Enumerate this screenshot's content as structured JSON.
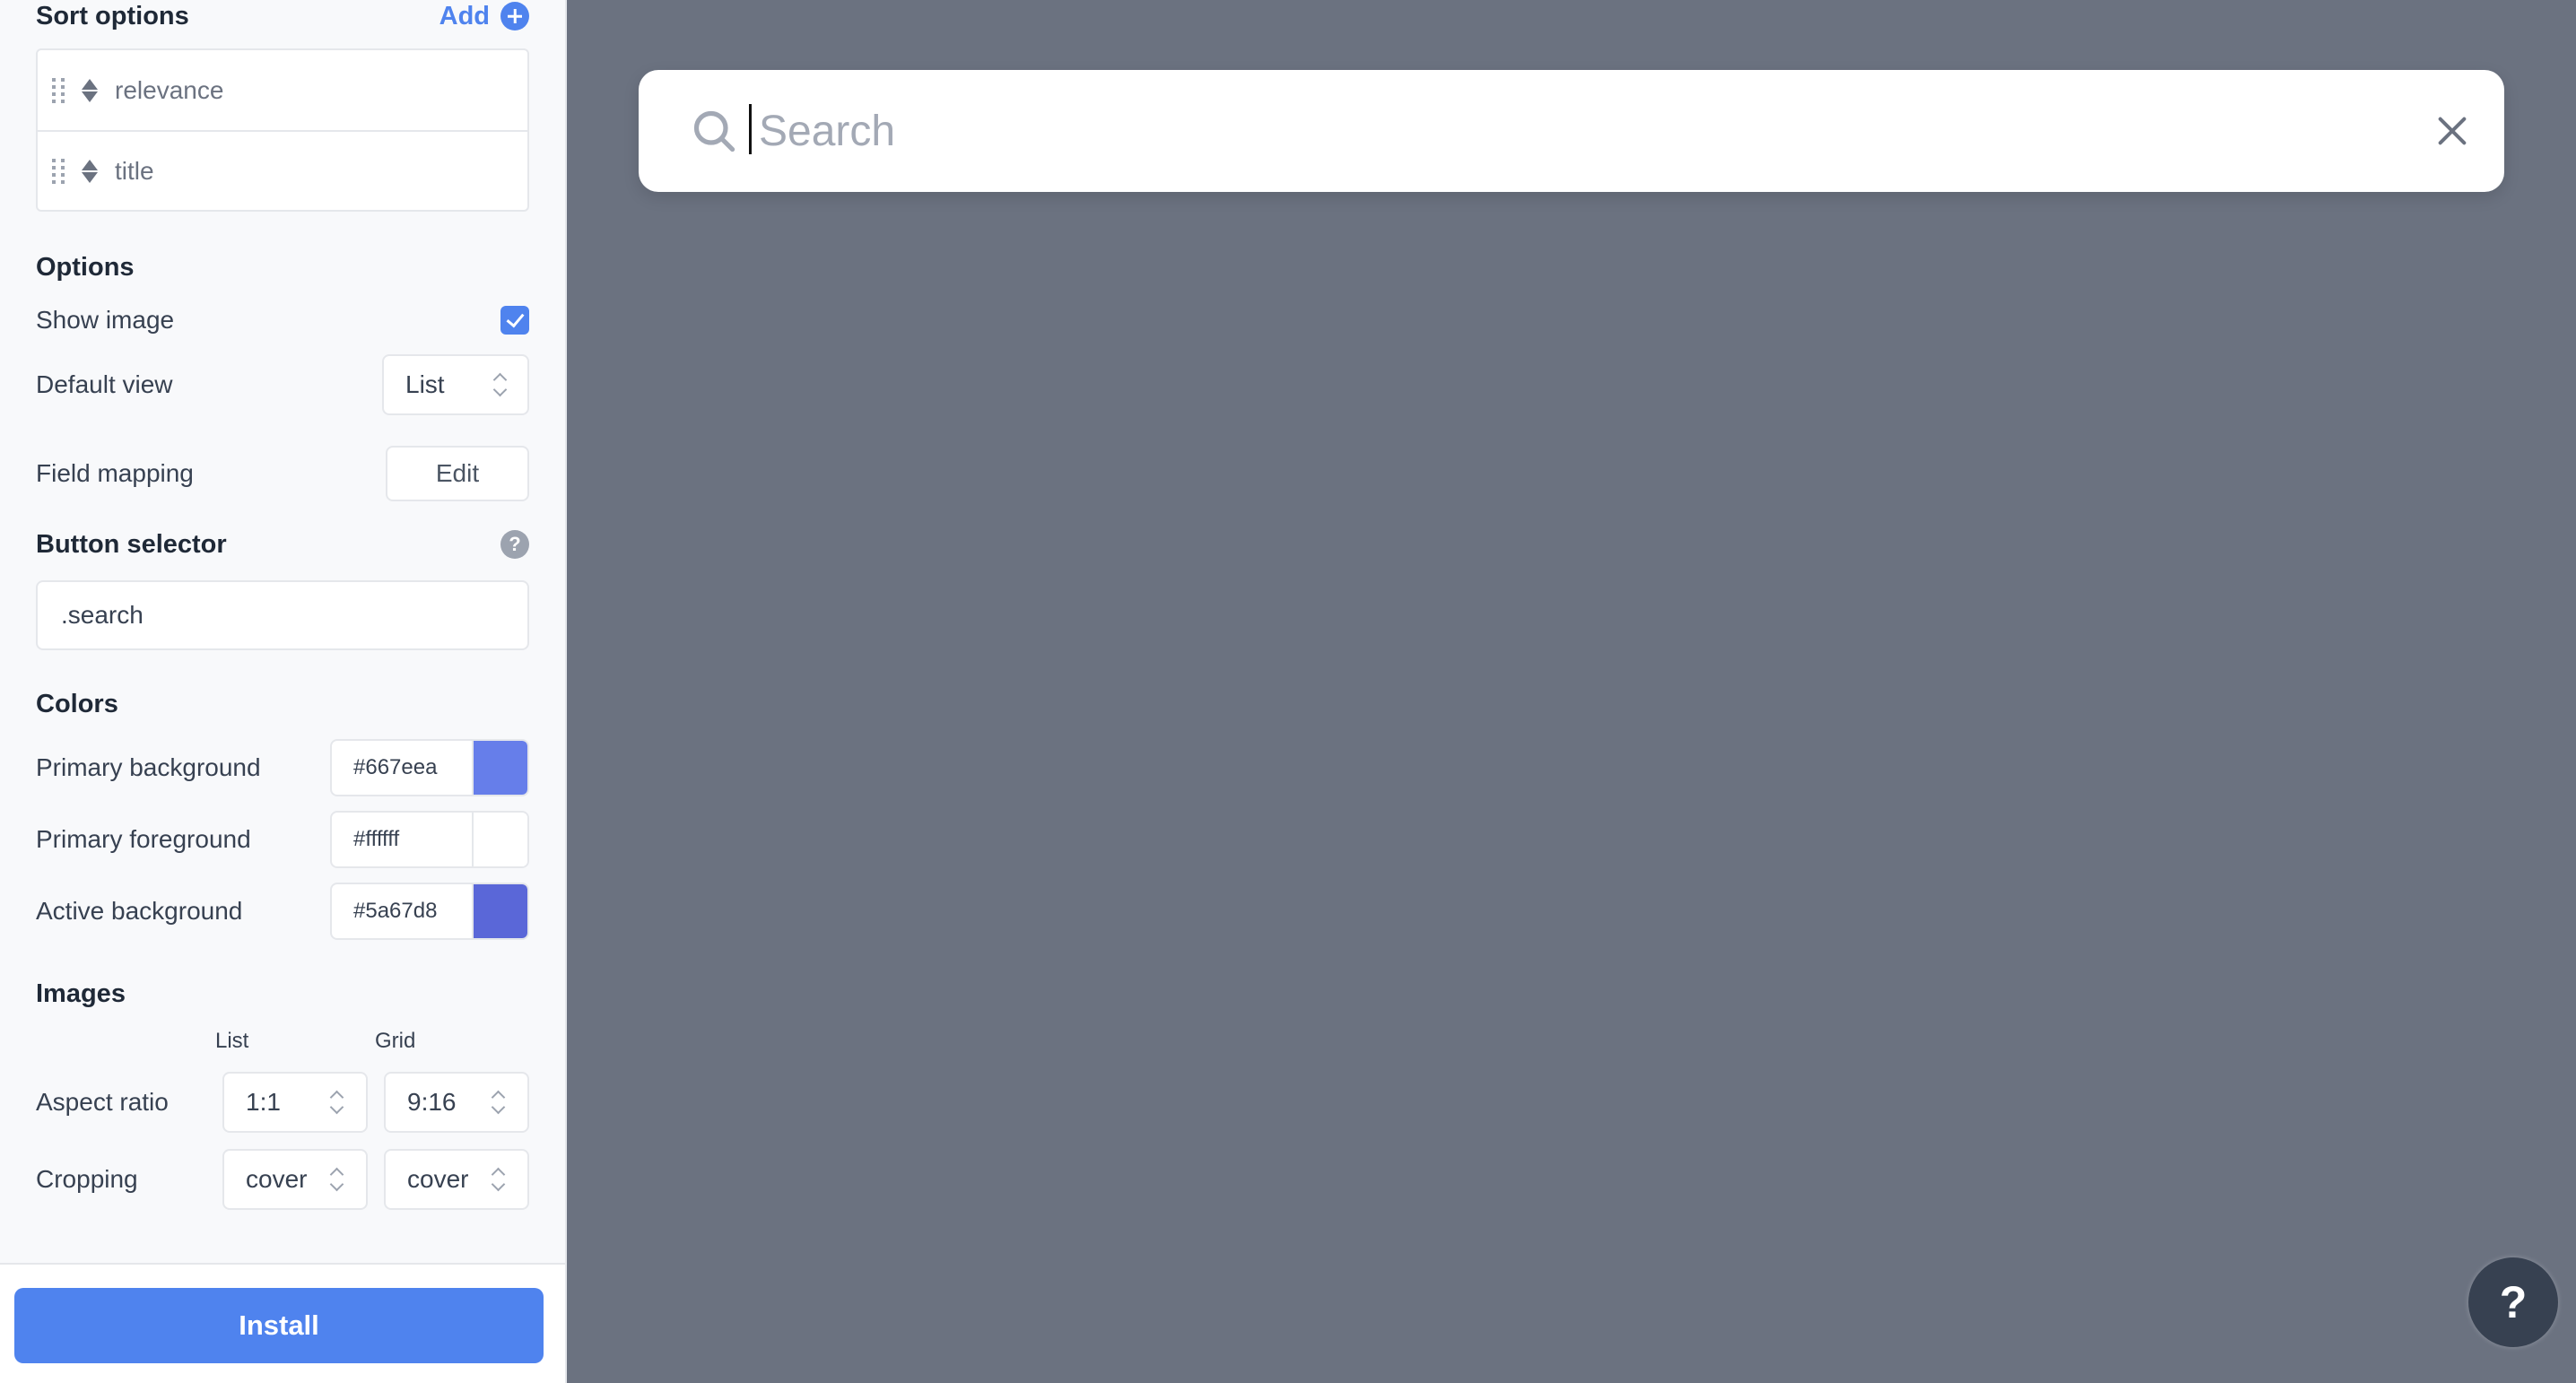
{
  "sidebar": {
    "sort_options": {
      "title": "Sort options",
      "add_label": "Add",
      "items": [
        {
          "label": "relevance"
        },
        {
          "label": "title"
        }
      ]
    },
    "options": {
      "title": "Options",
      "show_image_label": "Show image",
      "show_image_checked": true,
      "default_view_label": "Default view",
      "default_view_value": "List",
      "field_mapping_label": "Field mapping",
      "field_mapping_button": "Edit"
    },
    "button_selector": {
      "title": "Button selector",
      "help_glyph": "?",
      "value": ".search"
    },
    "colors": {
      "title": "Colors",
      "items": [
        {
          "label": "Primary background",
          "value": "#667eea",
          "swatch": "#667eea"
        },
        {
          "label": "Primary foreground",
          "value": "#ffffff",
          "swatch": "#ffffff"
        },
        {
          "label": "Active background",
          "value": "#5a67d8",
          "swatch": "#5a67d8"
        }
      ]
    },
    "images": {
      "title": "Images",
      "col_list": "List",
      "col_grid": "Grid",
      "aspect_ratio_label": "Aspect ratio",
      "aspect_ratio_list": "1:1",
      "aspect_ratio_grid": "9:16",
      "cropping_label": "Cropping",
      "cropping_list": "cover",
      "cropping_grid": "cover"
    },
    "install_label": "Install"
  },
  "search": {
    "placeholder": "Search",
    "value": "",
    "icon": "search-icon",
    "close_icon": "close-icon"
  },
  "help_fab": {
    "glyph": "?"
  },
  "colors": {
    "accent": "#4f83ee",
    "overlay": "#6b7280",
    "fab": "#374151"
  }
}
